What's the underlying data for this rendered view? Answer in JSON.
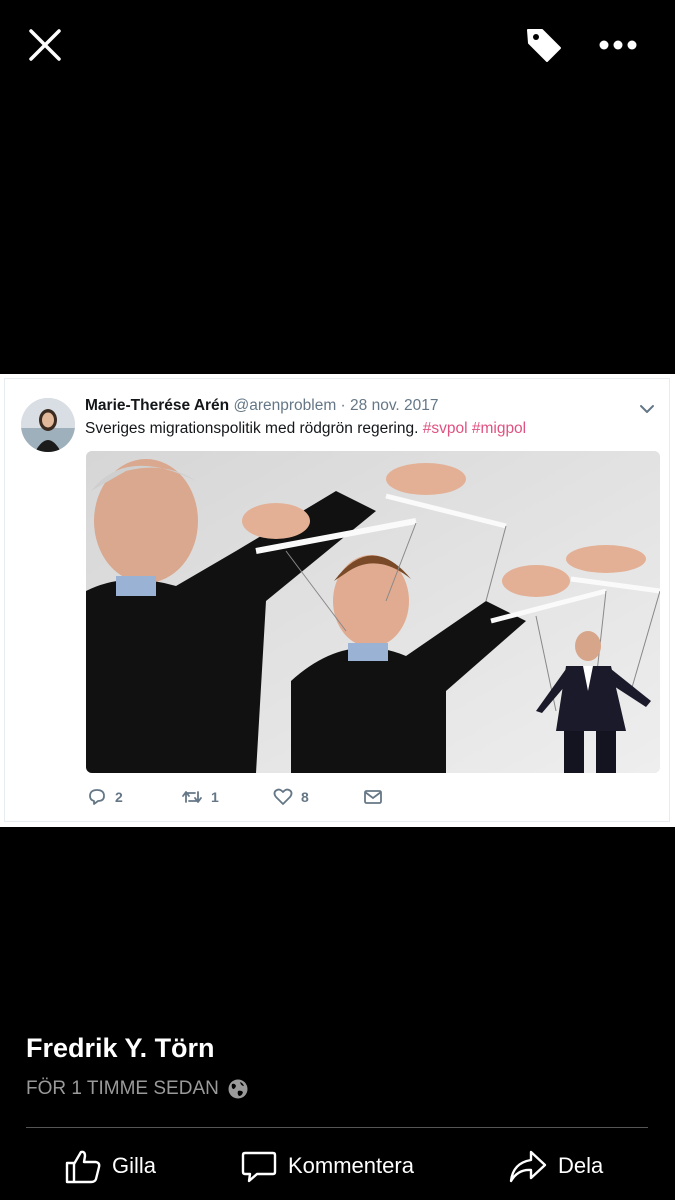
{
  "topbar": {
    "close_icon": "close-icon",
    "tag_icon": "tag-icon",
    "more_icon": "more-icon"
  },
  "tweet": {
    "name": "Marie-Therése Arén",
    "handle": "@arenproblem",
    "separator": "·",
    "date": "28 nov. 2017",
    "text": "Sveriges migrationspolitik med rödgrön regering.",
    "hashtags": "#svpol #migpol",
    "replies": "2",
    "retweets": "1",
    "likes": "8"
  },
  "post": {
    "author": "Fredrik Y. Törn",
    "time": "FÖR 1 TIMME SEDAN",
    "privacy_icon": "globe-icon"
  },
  "actions": {
    "like": "Gilla",
    "comment": "Kommentera",
    "share": "Dela"
  },
  "colors": {
    "background": "#000000",
    "hashtag": "#e0527f",
    "meta_text": "#9a9a9a"
  }
}
